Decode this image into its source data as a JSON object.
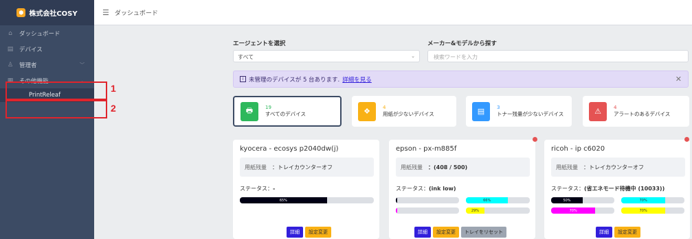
{
  "brand": {
    "name": "株式会社COSY",
    "logo_icon": "hexagon-logo"
  },
  "sidebar": {
    "items": [
      {
        "icon": "⌂",
        "label": "ダッシュボード"
      },
      {
        "icon": "▤",
        "label": "デバイス"
      },
      {
        "icon": "♙",
        "label": "管理者"
      },
      {
        "icon": "▦",
        "label": "その他機能"
      },
      {
        "label": "PrintReleaf"
      }
    ]
  },
  "annotations": {
    "one": "1",
    "two": "2"
  },
  "header": {
    "menu_icon": "☰",
    "title": "ダッシュボード"
  },
  "filters": {
    "agent_label": "エージェントを選択",
    "agent_value": "すべて",
    "maker_label": "メーカー&モデルから探す",
    "search_placeholder": "検索ワードを入力"
  },
  "alert": {
    "icon": "i",
    "text": "未管理のデバイスが 5 台あります.",
    "link": "詳細を見る",
    "close": "✕"
  },
  "summary": [
    {
      "count": "19",
      "label": "すべてのデバイス",
      "color": "#2eb85c",
      "icon": "🖶"
    },
    {
      "count": "4",
      "label": "用紙が少ないデバイス",
      "color": "#f9b115",
      "icon": "❖"
    },
    {
      "count": "3",
      "label": "トナー残量が少ないデバイス",
      "color": "#3399ff",
      "icon": "▤"
    },
    {
      "count": "4",
      "label": "アラートのあるデバイス",
      "color": "#e55353",
      "icon": "⚠"
    }
  ],
  "devices": [
    {
      "title": "kyocera - ecosys p2040dw(j)",
      "paper_label": "用紙残量",
      "paper_value": "：トレイカウンターオフ",
      "status_label": "ステータス：",
      "status_value": "-",
      "bars": [
        {
          "color": "#000015",
          "pct": 65,
          "label": "65%"
        }
      ],
      "buttons": [
        "詳細",
        "設定変更"
      ]
    },
    {
      "title": "epson - px-m885f",
      "paper_label": "用紙残量",
      "paper_value": "：(408 / 500)",
      "status_label": "ステータス：",
      "status_value": "(ink low)",
      "bars": [
        {
          "color": "#000015",
          "pct": 2,
          "label": ""
        },
        {
          "color": "#00ffff",
          "pct": 66,
          "label": "66%"
        },
        {
          "color": "#ff00ff",
          "pct": 2,
          "label": ""
        },
        {
          "color": "#ffff00",
          "pct": 29,
          "label": "29%"
        }
      ],
      "buttons": [
        "詳細",
        "設定変更",
        "トレイをリセット"
      ]
    },
    {
      "title": "ricoh - ip c6020",
      "paper_label": "用紙残量",
      "paper_value": "：トレイカウンターオフ",
      "status_label": "ステータス：",
      "status_value": "(省エネモード待機中 (10033))",
      "bars": [
        {
          "color": "#000015",
          "pct": 50,
          "label": "50%"
        },
        {
          "color": "#00ffff",
          "pct": 70,
          "label": "70%"
        },
        {
          "color": "#ff00ff",
          "pct": 70,
          "label": "70%"
        },
        {
          "color": "#ffff00",
          "pct": 70,
          "label": "70%"
        }
      ],
      "buttons": [
        "詳細",
        "設定変更"
      ]
    }
  ]
}
